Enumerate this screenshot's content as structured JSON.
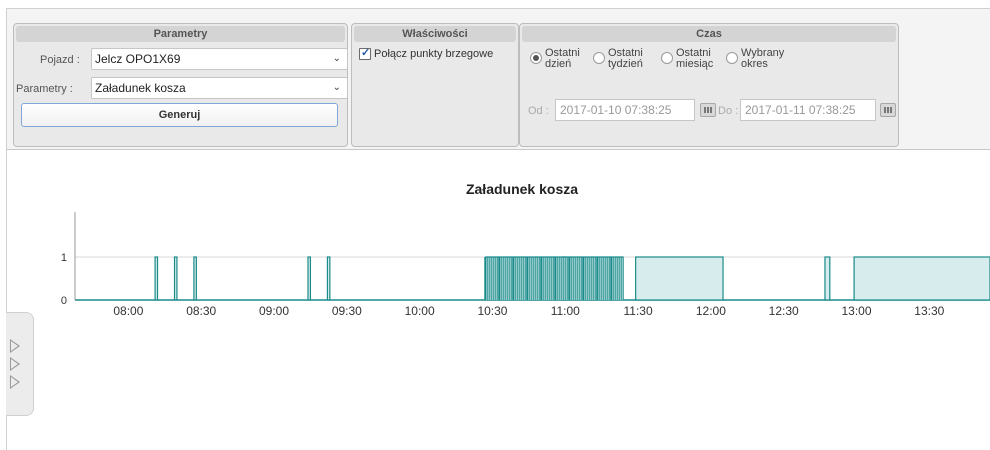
{
  "parametry_panel": {
    "title": "Parametry",
    "pojazd_label": "Pojazd :",
    "pojazd_value": "Jelcz OPO1X69",
    "parametry_label": "Parametry :",
    "parametry_value": "Załadunek kosza",
    "generate_label": "Generuj"
  },
  "wlasciwosci_panel": {
    "title": "Właściwości",
    "checkbox_label": "Połącz punkty brzegowe",
    "checked": true
  },
  "czas_panel": {
    "title": "Czas",
    "options": [
      {
        "line1": "Ostatni",
        "line2": "dzień",
        "selected": true
      },
      {
        "line1": "Ostatni",
        "line2": "tydzień",
        "selected": false
      },
      {
        "line1": "Ostatni",
        "line2": "miesiąc",
        "selected": false
      },
      {
        "line1": "Wybrany",
        "line2": "okres",
        "selected": false
      }
    ],
    "from_label": "Od :",
    "from_value": "2017-01-10 07:38:25",
    "to_label": "Do :",
    "to_value": "2017-01-11 07:38:25"
  },
  "colors": {
    "series_stroke": "#1a8a8a",
    "series_fill": "#d7ecec",
    "axis": "#999999",
    "grid": "#d8d8d8"
  },
  "chart_data": {
    "type": "area",
    "title": "Załadunek kosza",
    "step": true,
    "x_unit": "time-of-day",
    "xlim": [
      "07:38",
      "13:55"
    ],
    "ylim": [
      0,
      1
    ],
    "y_ticks": [
      "0",
      "1"
    ],
    "x_ticks": [
      "08:00",
      "08:30",
      "09:00",
      "09:30",
      "10:00",
      "10:30",
      "11:00",
      "11:30",
      "12:00",
      "12:30",
      "13:00",
      "13:30"
    ],
    "pulses": [
      [
        "08:11",
        "08:12"
      ],
      [
        "08:19",
        "08:20"
      ],
      [
        "08:27",
        "08:28"
      ],
      [
        "09:14",
        "09:15"
      ],
      [
        "09:22",
        "09:23"
      ],
      [
        "10:59",
        "11:00"
      ],
      [
        "12:47",
        "12:49"
      ]
    ],
    "dense_block": [
      "10:27",
      "11:24"
    ],
    "blocks": [
      [
        "11:29",
        "12:05"
      ],
      [
        "12:59",
        "13:55"
      ]
    ]
  }
}
